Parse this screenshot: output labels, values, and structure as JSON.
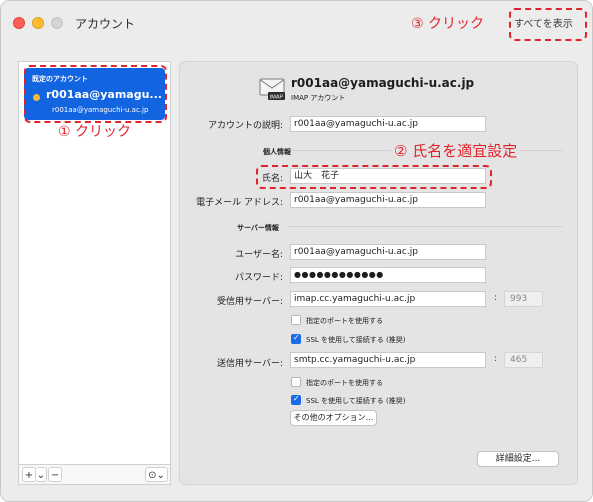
{
  "window": {
    "title": "アカウント",
    "show_all_label": "すべてを表示"
  },
  "annotations": {
    "step1": "① クリック",
    "step2": "② 氏名を適宜設定",
    "step3": "③ クリック",
    "color": "#e0242c"
  },
  "sidebar": {
    "default_caption": "既定のアカウント",
    "account_name": "r001aa@yamagu...",
    "account_email": "r001aa@yamaguchi-u.ac.jp",
    "add_label": "+",
    "add_chevron": "⌄",
    "remove_label": "−",
    "more_label": "⊙⌄"
  },
  "header": {
    "email": "r001aa@yamaguchi-u.ac.jp",
    "type": "IMAP アカウント",
    "icon": "mail-envelope-icon",
    "icon_tag": "IMAP"
  },
  "form": {
    "description_label": "アカウントの説明:",
    "description_value": "r001aa@yamaguchi-u.ac.jp",
    "personal_section": "個人情報",
    "name_label": "氏名:",
    "name_value": "山大　花子",
    "email_label": "電子メール アドレス:",
    "email_value": "r001aa@yamaguchi-u.ac.jp",
    "server_section": "サーバー情報",
    "username_label": "ユーザー名:",
    "username_value": "r001aa@yamaguchi-u.ac.jp",
    "password_label": "パスワード:",
    "password_value": "●●●●●●●●●●●●",
    "incoming_label": "受信用サーバー:",
    "incoming_value": "imap.cc.yamaguchi-u.ac.jp",
    "incoming_port": "993",
    "incoming_custom_port": "指定のポートを使用する",
    "incoming_ssl": "SSL を使用して接続する (推奨)",
    "outgoing_label": "送信用サーバー:",
    "outgoing_value": "smtp.cc.yamaguchi-u.ac.jp",
    "outgoing_port": "465",
    "outgoing_custom_port": "指定のポートを使用する",
    "outgoing_ssl": "SSL を使用して接続する (推奨)",
    "other_options": "その他のオプション...",
    "advanced": "詳細設定...",
    "port_colon": ":"
  }
}
